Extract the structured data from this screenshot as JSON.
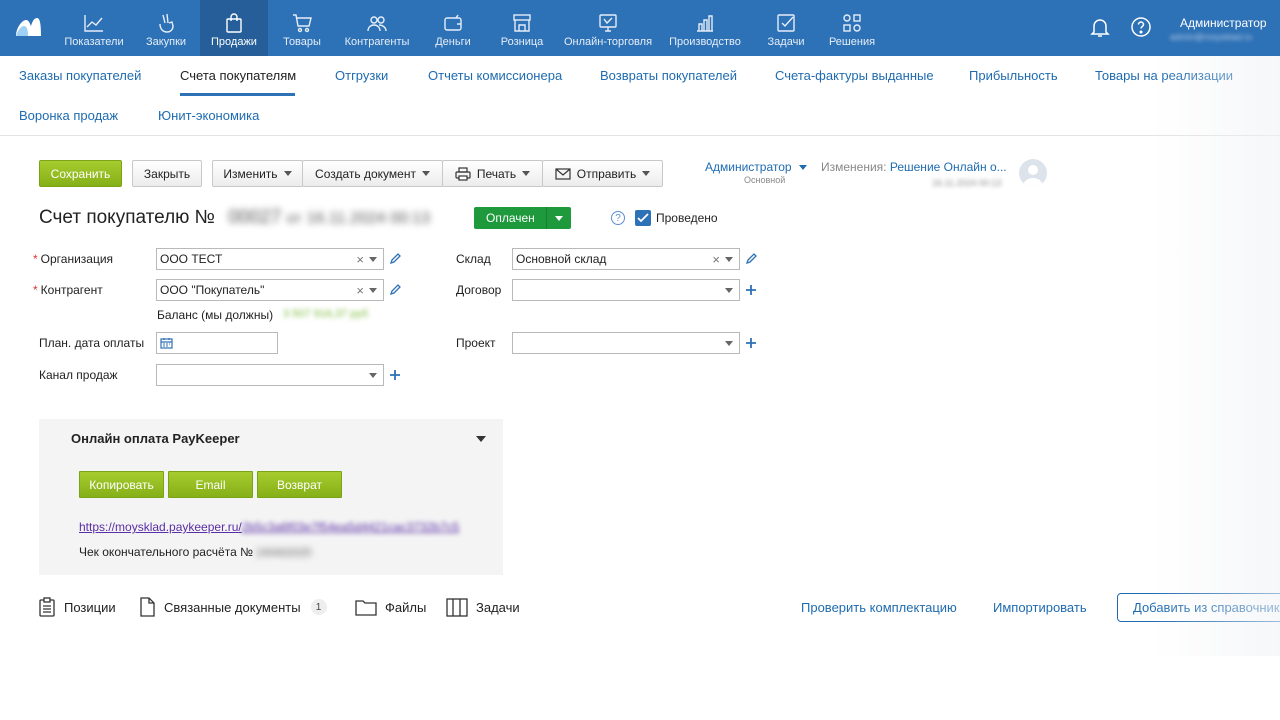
{
  "colors": {
    "brand": "#2d71b6",
    "accent_green": "#8bb51d",
    "status_green": "#1e9a3c",
    "link": "#1f6bb0"
  },
  "topnav": {
    "items": [
      {
        "label": "Показатели",
        "icon": "chart-line-icon"
      },
      {
        "label": "Закупки",
        "icon": "purchase-hand-icon"
      },
      {
        "label": "Продажи",
        "icon": "shopping-bag-icon",
        "active": true
      },
      {
        "label": "Товары",
        "icon": "cart-icon"
      },
      {
        "label": "Контрагенты",
        "icon": "people-icon"
      },
      {
        "label": "Деньги",
        "icon": "wallet-icon"
      },
      {
        "label": "Розница",
        "icon": "store-icon"
      },
      {
        "label": "Онлайн-торговля",
        "icon": "online-store-icon"
      },
      {
        "label": "Производство",
        "icon": "bar-chart-icon"
      },
      {
        "label": "Задачи",
        "icon": "task-check-icon"
      },
      {
        "label": "Решения",
        "icon": "apps-grid-icon"
      }
    ],
    "user_name": "Администратор",
    "user_email": "admin@moysklad.ru"
  },
  "subnav": {
    "items": [
      "Заказы покупателей",
      "Счета покупателям",
      "Отгрузки",
      "Отчеты комиссионера",
      "Возвраты покупателей",
      "Счета-фактуры выданные",
      "Прибыльность",
      "Товары на реализации",
      "Воронка продаж",
      "Юнит-экономика"
    ],
    "active": "Счета покупателям"
  },
  "toolbar": {
    "save": "Сохранить",
    "close": "Закрыть",
    "edit": "Изменить",
    "create_doc": "Создать документ",
    "print": "Печать",
    "send": "Отправить"
  },
  "owner": {
    "name": "Администратор",
    "group": "Основной"
  },
  "changes": {
    "label": "Изменения:",
    "link": "Решение Онлайн о...",
    "date": "16.11.2024 00:13"
  },
  "document": {
    "title": "Счет покупателю №",
    "number": "00027",
    "from_label": "от",
    "date": "16.11.2024 00:13",
    "status": "Оплачен",
    "posted_label": "Проведено",
    "posted": true
  },
  "form": {
    "organization_label": "Организация",
    "organization_value": "ООО ТЕСТ",
    "warehouse_label": "Склад",
    "warehouse_value": "Основной склад",
    "counterparty_label": "Контрагент",
    "counterparty_value": "ООО \"Покупатель\"",
    "contract_label": "Договор",
    "contract_value": "",
    "balance_label": "Баланс (мы должны)",
    "balance_value": "3 507 916,37 руб",
    "pay_date_label": "План. дата оплаты",
    "pay_date_value": "",
    "project_label": "Проект",
    "project_value": "",
    "channel_label": "Канал продаж",
    "channel_value": ""
  },
  "paykeeper": {
    "title": "Онлайн оплата PayKeeper",
    "copy": "Копировать",
    "email": "Email",
    "refund": "Возврат",
    "link_prefix": "https://moysklad.paykeeper.ru/",
    "link_hash": "2b5c3a6f03e7f54ea5d4421cac3732b7c5",
    "check_label": "Чек окончательного расчёта №",
    "check_number": "240402025"
  },
  "bottom": {
    "positions": "Позиции",
    "related": "Связанные документы",
    "related_count": "1",
    "files": "Файлы",
    "tasks": "Задачи",
    "check_kit": "Проверить комплектацию",
    "import": "Импортировать",
    "add_from_ref": "Добавить из справочника"
  }
}
